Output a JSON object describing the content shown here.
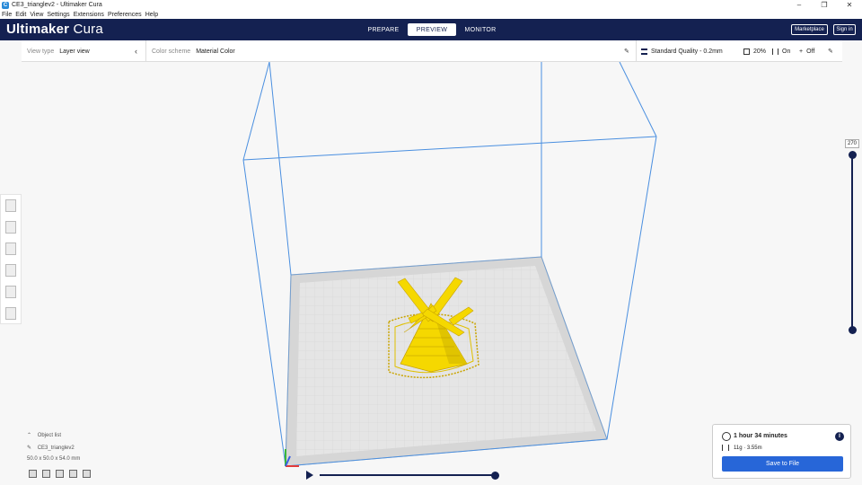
{
  "window": {
    "title": "CE3_trianglev2 - Ultimaker Cura",
    "minimize": "–",
    "maximize": "❐",
    "close": "✕"
  },
  "menu": [
    "File",
    "Edit",
    "View",
    "Settings",
    "Extensions",
    "Preferences",
    "Help"
  ],
  "header": {
    "brand_bold": "Ultimaker",
    "brand_light": "Cura",
    "stages": [
      "PREPARE",
      "PREVIEW",
      "MONITOR"
    ],
    "active_stage": "PREVIEW",
    "marketplace": "Marketplace",
    "sign_in": "Sign in"
  },
  "toolbar": {
    "view_type_label": "View type",
    "view_type_value": "Layer view",
    "color_scheme_label": "Color scheme",
    "color_scheme_value": "Material Color",
    "quality": "Standard Quality - 0.2mm",
    "infill": "20%",
    "support": "On",
    "adhesion": "Off"
  },
  "layer_slider": {
    "current_layer": "270"
  },
  "object_list": {
    "header": "Object list",
    "object_name": "CE3_trianglev2",
    "dimensions": "50.0 x 50.0 x 54.0 mm"
  },
  "print_panel": {
    "time": "1 hour 34 minutes",
    "material": "11g · 3.55m",
    "save_button": "Save to File"
  },
  "colors": {
    "header_bg": "#142151",
    "accent": "#2766d8",
    "model": "#f5d800",
    "build_volume": "#4a8fe0"
  }
}
